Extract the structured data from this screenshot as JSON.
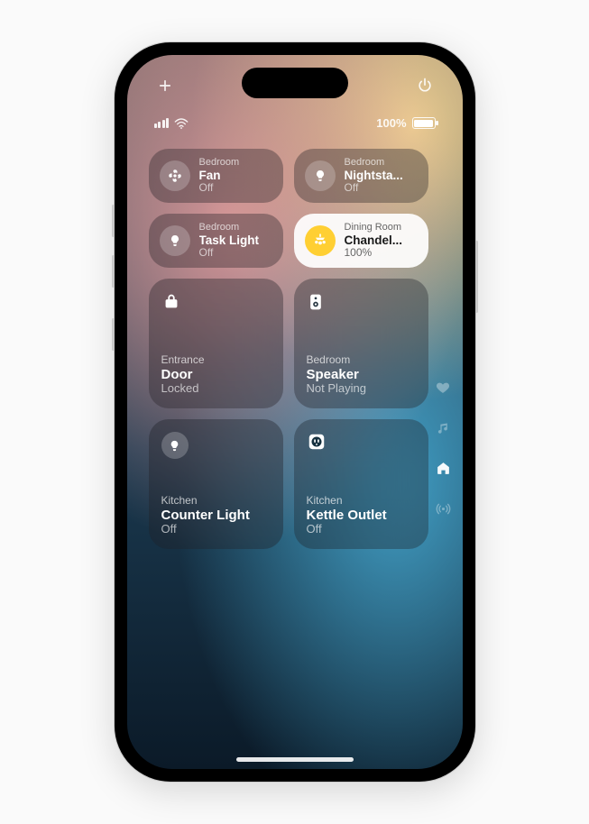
{
  "status": {
    "battery_pct": "100%"
  },
  "tiles": {
    "fan": {
      "room": "Bedroom",
      "name": "Fan",
      "state": "Off"
    },
    "nightstand": {
      "room": "Bedroom",
      "name": "Nightsta...",
      "state": "Off"
    },
    "task": {
      "room": "Bedroom",
      "name": "Task Light",
      "state": "Off"
    },
    "chandelier": {
      "room": "Dining Room",
      "name": "Chandel...",
      "state": "100%"
    },
    "door": {
      "room": "Entrance",
      "name": "Door",
      "state": "Locked"
    },
    "speaker": {
      "room": "Bedroom",
      "name": "Speaker",
      "state": "Not Playing"
    },
    "counter": {
      "room": "Kitchen",
      "name": "Counter Light",
      "state": "Off"
    },
    "kettle": {
      "room": "Kitchen",
      "name": "Kettle Outlet",
      "state": "Off"
    }
  }
}
